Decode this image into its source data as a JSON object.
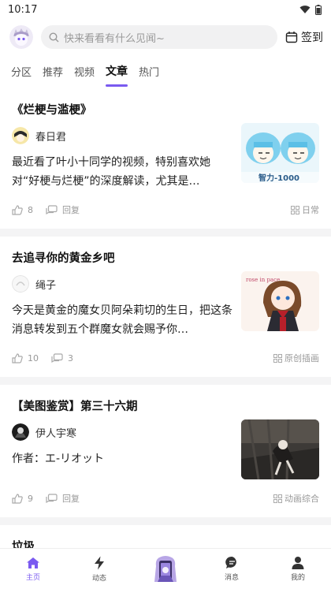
{
  "status_bar": {
    "time": "10:17"
  },
  "header": {
    "search_placeholder": "快来看看有什么见闻~",
    "checkin_label": "签到"
  },
  "tabs": [
    {
      "label": "分区"
    },
    {
      "label": "推荐"
    },
    {
      "label": "视频"
    },
    {
      "label": "文章",
      "active": true
    },
    {
      "label": "热门"
    }
  ],
  "posts": [
    {
      "title": "《烂梗与滥梗》",
      "author": "春日君",
      "excerpt": "最近看了叶小十同学的视频，特别喜欢她对“好梗与烂梗”的深度解读，尤其是…",
      "thumb_caption": "智力-1000",
      "likes": "8",
      "comments": "回复",
      "tag": "日常"
    },
    {
      "title": "去追寻你的黄金乡吧",
      "author": "绳子",
      "excerpt": "今天是黄金的魔女贝阿朵莉切的生日，把这条消息转发到五个群魔女就会赐予你…",
      "thumb_caption": "rose in pace",
      "likes": "10",
      "comments": "3",
      "tag": "原创插画"
    },
    {
      "title": "【美图鉴赏】第三十六期",
      "author": "伊人宇寒",
      "excerpt": "作者：エ-リオット",
      "likes": "9",
      "comments": "回复",
      "tag": "动画综合"
    },
    {
      "title": "垃圾"
    }
  ],
  "bottom_nav": [
    {
      "label": "主页",
      "icon": "home-icon",
      "active": true
    },
    {
      "label": "动态",
      "icon": "lightning-icon"
    },
    {
      "label": "",
      "icon": "mascot-icon"
    },
    {
      "label": "消息",
      "icon": "chat-icon"
    },
    {
      "label": "我的",
      "icon": "profile-icon"
    }
  ],
  "colors": {
    "accent": "#7a5af0",
    "muted": "#999999"
  }
}
